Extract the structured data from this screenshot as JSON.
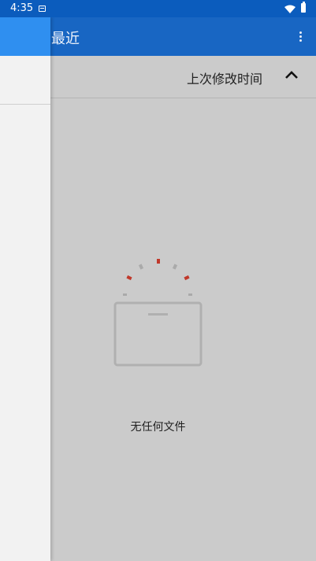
{
  "status_bar": {
    "time": "4:35"
  },
  "toolbar": {
    "title": "最近"
  },
  "sort": {
    "label": "上次修改时间",
    "direction": "ascending"
  },
  "empty_state": {
    "message": "无任何文件"
  },
  "icons": {
    "overflow": "more-vert-icon",
    "sort_toggle": "chevron-up-icon",
    "empty": "empty-box-icon"
  },
  "colors": {
    "status_bar": "#0b5cbd",
    "toolbar": "#1866c3",
    "drawer_header": "#2f8ff0",
    "scrim": "#cbcbcb",
    "accent_red": "#c0392b"
  }
}
